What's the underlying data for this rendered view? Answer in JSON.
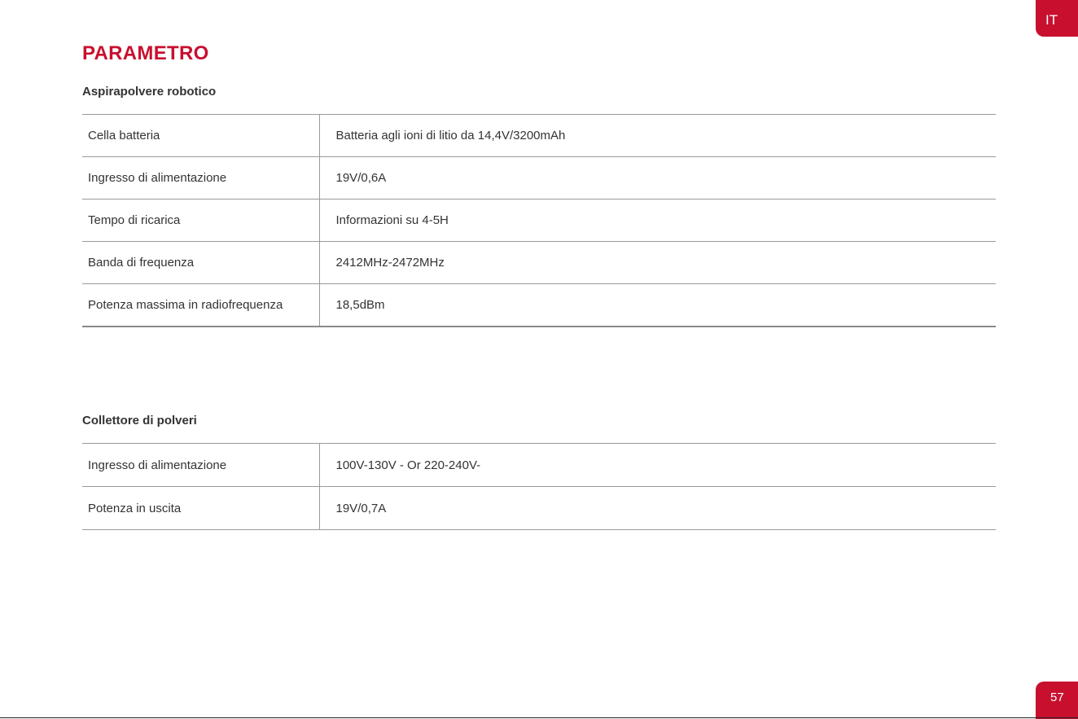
{
  "lang_tab": "IT",
  "page_number": "57",
  "title": "PARAMETRO",
  "robot_section": {
    "heading": "Aspirapolvere robotico",
    "rows": [
      {
        "label": "Cella batteria",
        "value": "Batteria agli ioni di litio da 14,4V/3200mAh"
      },
      {
        "label": "Ingresso di alimentazione",
        "value": "19V/0,6A"
      },
      {
        "label": "Tempo di ricarica",
        "value": "Informazioni su 4-5H"
      },
      {
        "label": "Banda di frequenza",
        "value": "2412MHz-2472MHz"
      },
      {
        "label": "Potenza massima in radiofrequenza",
        "value": "18,5dBm"
      }
    ]
  },
  "dust_section": {
    "heading": "Collettore di polveri",
    "rows": [
      {
        "label": "Ingresso di alimentazione",
        "value": "100V-130V - Or 220-240V-"
      },
      {
        "label": "Potenza in uscita",
        "value": "19V/0,7A"
      }
    ]
  },
  "colors": {
    "accent": "#c8102e",
    "text": "#333333",
    "rule": "#9a9a9a"
  }
}
